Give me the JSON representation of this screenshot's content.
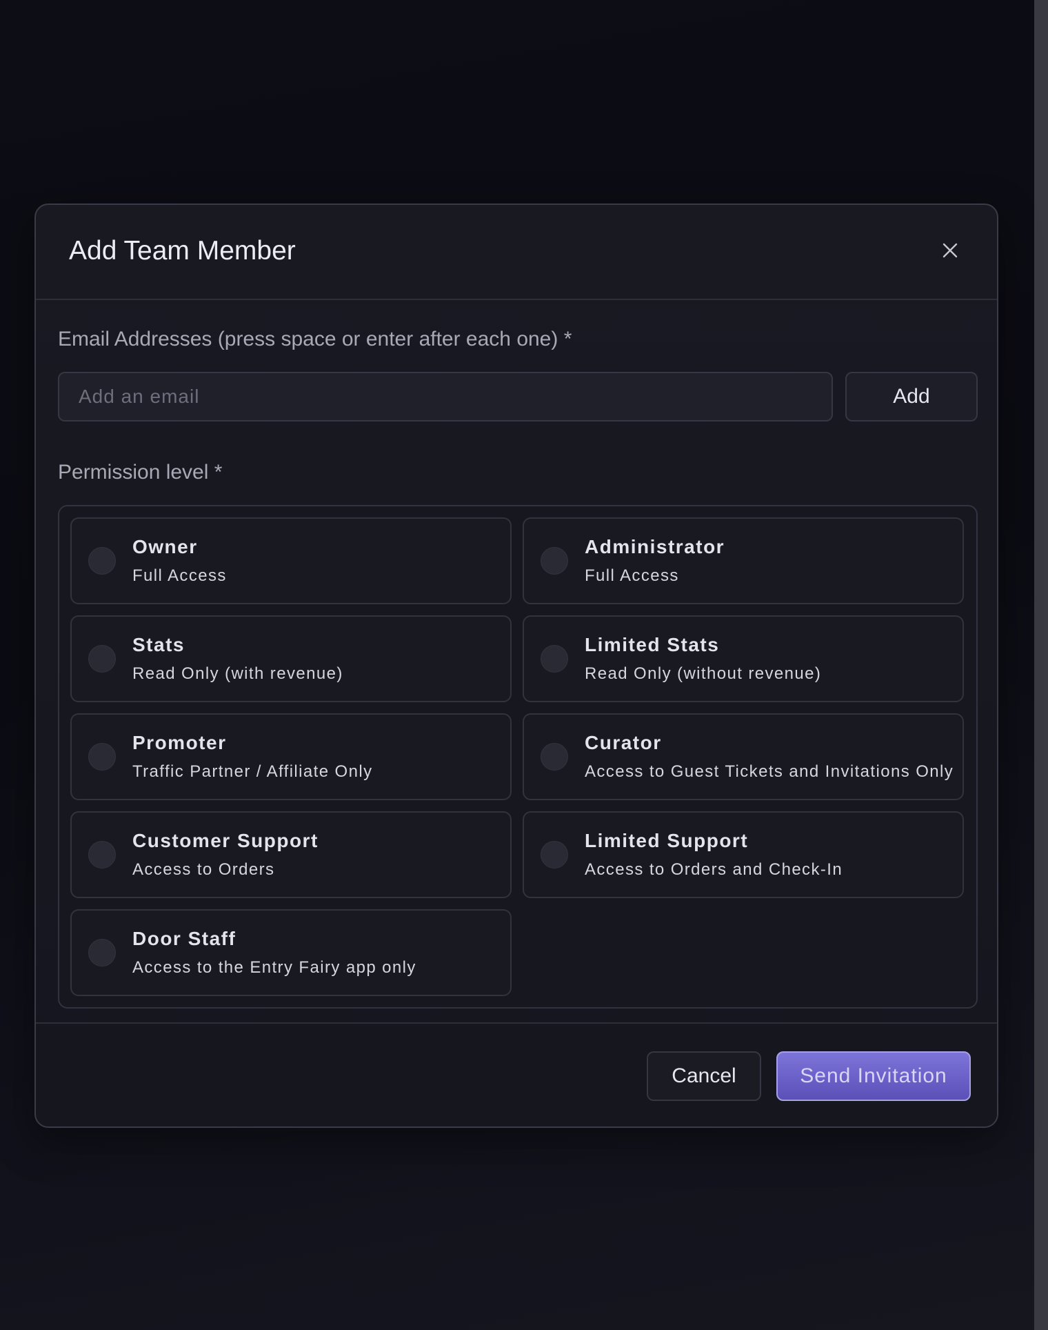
{
  "modal": {
    "title": "Add Team Member",
    "close_icon": "close-icon"
  },
  "email": {
    "label": "Email Addresses (press space or enter after each one) *",
    "placeholder": "Add an email",
    "value": "",
    "add_label": "Add"
  },
  "permissions": {
    "label": "Permission level *",
    "options": [
      {
        "title": "Owner",
        "description": "Full Access"
      },
      {
        "title": "Administrator",
        "description": "Full Access"
      },
      {
        "title": "Stats",
        "description": "Read Only (with revenue)"
      },
      {
        "title": "Limited Stats",
        "description": "Read Only (without revenue)"
      },
      {
        "title": "Promoter",
        "description": "Traffic Partner / Affiliate Only"
      },
      {
        "title": "Curator",
        "description": "Access to Guest Tickets and Invitations Only"
      },
      {
        "title": "Customer Support",
        "description": "Access to Orders"
      },
      {
        "title": "Limited Support",
        "description": "Access to Orders and Check-In"
      },
      {
        "title": "Door Staff",
        "description": "Access to the Entry Fairy app only"
      }
    ]
  },
  "footer": {
    "cancel_label": "Cancel",
    "send_label": "Send Invitation"
  },
  "colors": {
    "background": "#0c0c14",
    "modal_bg": "#181821",
    "accent": "#6c63cc"
  }
}
